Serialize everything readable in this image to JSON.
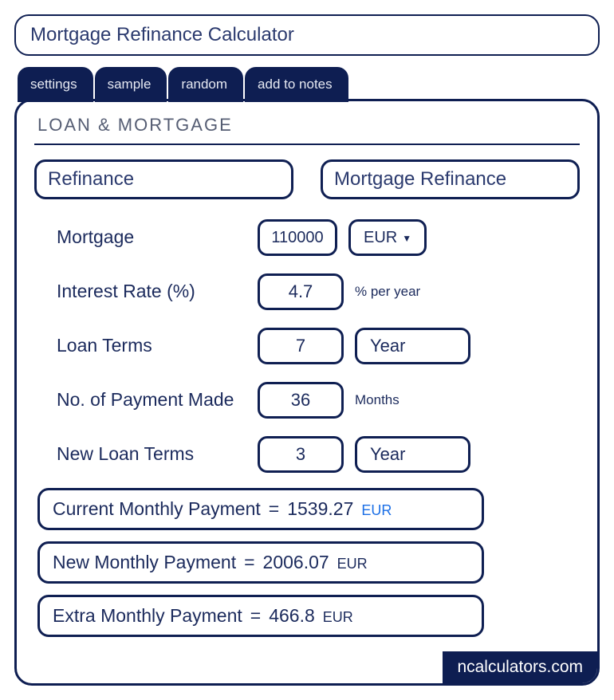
{
  "title": "Mortgage Refinance Calculator",
  "tabs": [
    "settings",
    "sample",
    "random",
    "add to notes"
  ],
  "section_title": "LOAN & MORTGAGE",
  "categories": {
    "left": "Refinance",
    "right": "Mortgage Refinance"
  },
  "fields": {
    "mortgage": {
      "label": "Mortgage",
      "value": "110000",
      "currency": "EUR"
    },
    "interest_rate": {
      "label": "Interest Rate (%)",
      "value": "4.7",
      "suffix": "% per year"
    },
    "loan_terms": {
      "label": "Loan Terms",
      "value": "7",
      "unit": "Year"
    },
    "payments_made": {
      "label": "No. of Payment Made",
      "value": "36",
      "suffix": "Months"
    },
    "new_loan_terms": {
      "label": "New Loan Terms",
      "value": "3",
      "unit": "Year"
    }
  },
  "results": {
    "current": {
      "label": "Current Monthly Payment",
      "value": "1539.27",
      "currency": "EUR"
    },
    "new": {
      "label": "New Monthly Payment",
      "value": "2006.07",
      "currency": "EUR"
    },
    "extra": {
      "label": "Extra Monthly Payment",
      "value": "466.8",
      "currency": "EUR"
    }
  },
  "footer": "ncalculators.com"
}
